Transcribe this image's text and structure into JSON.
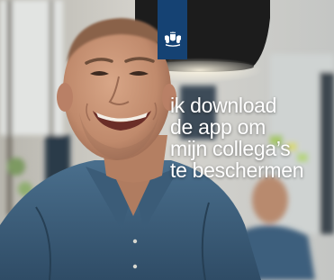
{
  "ad": {
    "headline_lines": [
      "ik download",
      "de app om",
      "mijn collega’s",
      "te beschermen"
    ],
    "brand_color": "#154273",
    "logo_icon": "rijksoverheid-lion-emblem-icon",
    "photo": "smiling-man-in-denim-shirt-photo"
  }
}
